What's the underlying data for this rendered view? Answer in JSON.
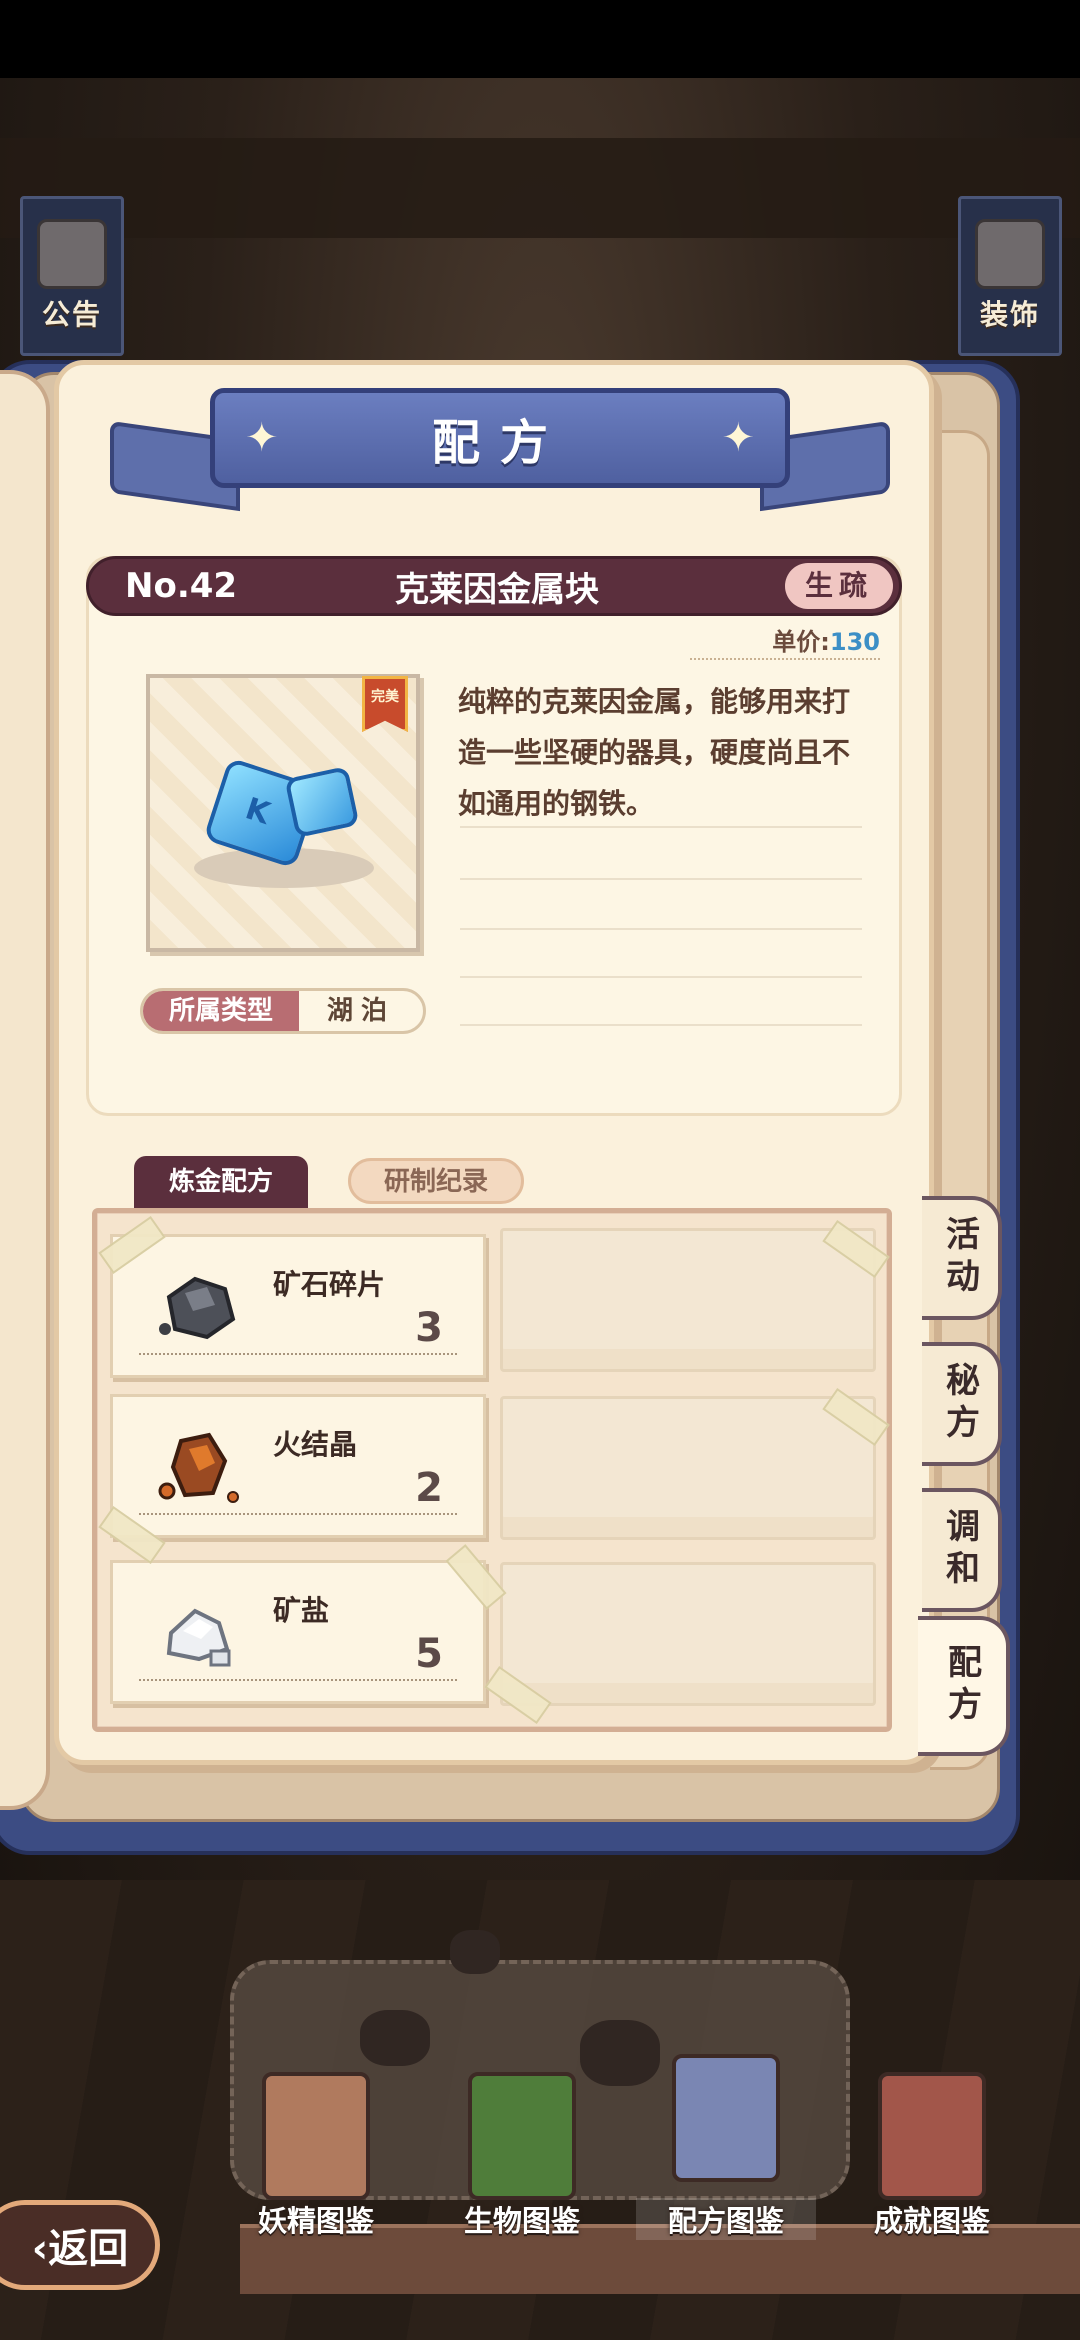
{
  "side_banners": {
    "left_label": "公告",
    "right_label": "装饰"
  },
  "header": {
    "title": "配方"
  },
  "item": {
    "number": "No.42",
    "name": "克莱因金属块",
    "tag": "生疏",
    "price_label": "单价:",
    "price_value": "130",
    "rarity_badge": "完美",
    "type_label": "所属类型",
    "type_value": "湖泊",
    "description": "纯粹的克莱因金属，能够用来打造一些坚硬的器具，硬度尚且不如通用的钢铁。"
  },
  "recipe_tabs": {
    "active": "炼金配方",
    "inactive": "研制纪录"
  },
  "ingredients": [
    {
      "name": "矿石碎片",
      "qty": "3",
      "icon": "ore-fragment-icon"
    },
    {
      "name": "火结晶",
      "qty": "2",
      "icon": "fire-crystal-icon"
    },
    {
      "name": "矿盐",
      "qty": "5",
      "icon": "mineral-salt-icon"
    }
  ],
  "side_tabs": [
    {
      "label": "活动"
    },
    {
      "label": "秘方"
    },
    {
      "label": "调和"
    },
    {
      "label": "配方"
    }
  ],
  "bottom_nav": [
    {
      "label": "妖精图鉴",
      "icon": "fairy-book-icon"
    },
    {
      "label": "生物图鉴",
      "icon": "creature-book-icon"
    },
    {
      "label": "配方图鉴",
      "icon": "recipe-book-icon"
    },
    {
      "label": "成就图鉴",
      "icon": "achievement-book-icon"
    }
  ],
  "back_button": {
    "label": "返回"
  },
  "colors": {
    "ribbon": "#5e6fab",
    "title_bar": "#5b2f3d",
    "price_value": "#3c8fc6",
    "page": "#fbf1dc"
  }
}
